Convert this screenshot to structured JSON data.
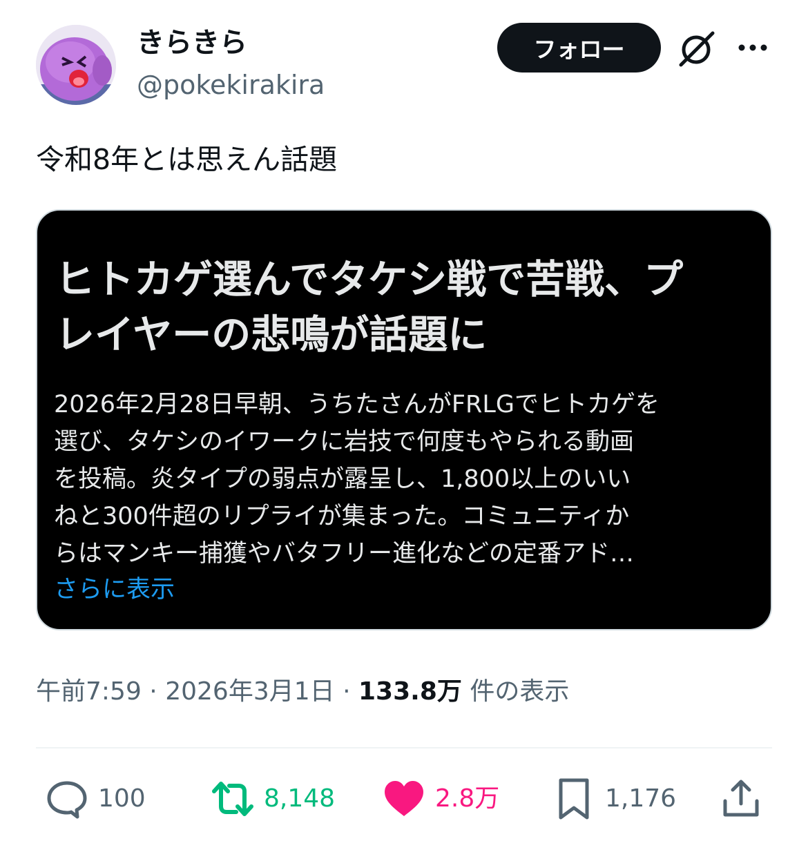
{
  "author": {
    "display_name": "きらきら",
    "handle": "@pokekirakira",
    "avatar_icon": "purple-creature-avatar"
  },
  "header": {
    "follow_label": "フォロー",
    "grok_icon": "grok-icon",
    "more_icon": "more-dots-icon"
  },
  "tweet": {
    "text": "令和8年とは思えん話題"
  },
  "card": {
    "title_lines": [
      "ヒトカゲ選んでタケシ戦で苦戦、プ",
      "レイヤーの悲鳴が話題に"
    ],
    "body_lines": [
      "2026年2月28日早朝、うちたさんがFRLGでヒトカゲを",
      "選び、タケシのイワークに岩技で何度もやられる動画",
      "を投稿。炎タイプの弱点が露呈し、1,800以上のいい",
      "ねと300件超のリプライが集まった。コミュニティか",
      "らはマンキー捕獲やバタフリー進化などの定番アド…"
    ],
    "show_more": "さらに表示"
  },
  "meta": {
    "time": "午前7:59",
    "separator": "·",
    "date": "2026年3月1日",
    "views_count": "133.8万",
    "views_label": "件の表示"
  },
  "actions": {
    "reply_count": "100",
    "retweet_count": "8,148",
    "like_count": "2.8万",
    "bookmark_count": "1,176"
  },
  "colors": {
    "text_primary": "#0f1419",
    "text_secondary": "#536471",
    "link_blue": "#1d9bf0",
    "retweet_green": "#00ba7c",
    "like_pink": "#f91880",
    "card_bg": "#000000"
  }
}
